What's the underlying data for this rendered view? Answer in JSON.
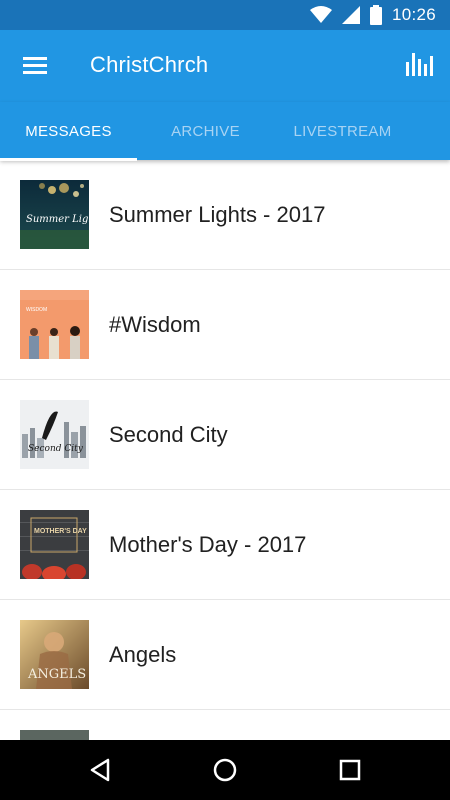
{
  "status_bar": {
    "time": "10:26",
    "icons": [
      "wifi-icon",
      "cell-signal-icon",
      "battery-icon"
    ]
  },
  "app_bar": {
    "title": "ChristChrch",
    "menu_icon": "hamburger-menu-icon",
    "action_icon": "bar-chart-icon"
  },
  "tabs": [
    {
      "label": "MESSAGES",
      "active": true
    },
    {
      "label": "ARCHIVE",
      "active": false
    },
    {
      "label": "LIVESTREAM",
      "active": false
    }
  ],
  "messages": [
    {
      "title": "Summer Lights - 2017",
      "thumb_text": "Summer Lights"
    },
    {
      "title": "#Wisdom",
      "thumb_text": "WISDOM"
    },
    {
      "title": "Second City",
      "thumb_text": "Second City"
    },
    {
      "title": "Mother's Day - 2017",
      "thumb_text": "MOTHER'S DAY"
    },
    {
      "title": "Angels",
      "thumb_text": "ANGELS"
    }
  ],
  "nav_bar": {
    "icons": [
      "back-icon",
      "home-icon",
      "recents-icon"
    ]
  },
  "colors": {
    "status_bar": "#1a73b8",
    "primary": "#2196e3",
    "tab_inactive": "#a8d3f3",
    "text_primary": "#212121"
  }
}
